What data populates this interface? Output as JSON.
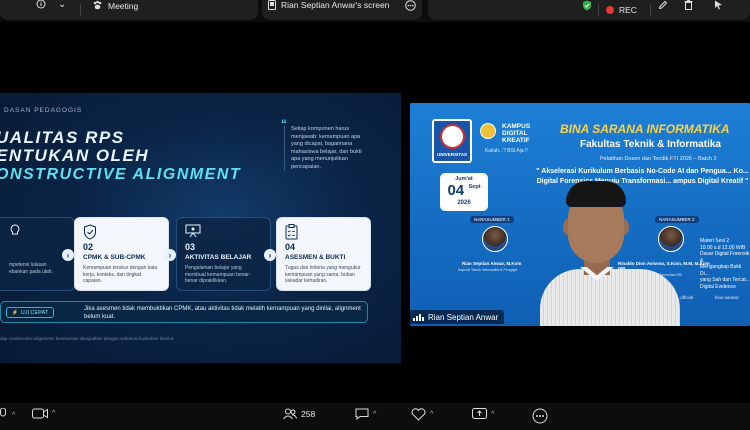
{
  "topbar": {
    "info_icon": "info-icon",
    "meeting_label": "Meeting",
    "screen_label": "Rian Septian Anwar's screen",
    "rec_label": "REC"
  },
  "slide": {
    "kicker": "DASAN PEDAGOGIS",
    "title_line1": "UALITAS RPS",
    "title_line2": "ENTUKAN OLEH",
    "title_line3": "ONSTRUCTIVE ALIGNMENT",
    "side_note": "Setiap komponen harus menjawab: kemampuan apa yang dicapai, bagaimana mahasiswa belajar, dan bukti apa yang menunjukkan pencapaian.",
    "cards": [
      {
        "num": "",
        "title": "",
        "desc": "mpetensi lulusan ebankan pada ulah."
      },
      {
        "num": "02",
        "title": "CPMK & SUB-CPMK",
        "desc": "Kemampuan terukur dengan kata kerja, konteks, dan tingkat capaian."
      },
      {
        "num": "03",
        "title": "AKTIVITAS BELAJAR",
        "desc": "Pengalaman belajar yang membuat kemampuan benar-benar dipraktikkan."
      },
      {
        "num": "04",
        "title": "ASESMEN & BUKTI",
        "desc": "Tugas dan kriteria yang mengukur kemampuan yang sama, bukan sekadar kehadiran."
      }
    ],
    "uji_label": "UJI CEPAT",
    "uji_text": "Jika asesmen tidak membuktikan CPMK, atau aktivitas tidak melatih kemampuan yang dinilai, alignment belum kuat.",
    "footnote": "dap constructive alignment: kesesuaian diwujudkan dengan sekuensi kurikulum tinstrut."
  },
  "webcam": {
    "univ_label": "UNIVERSITAS",
    "kdk": "KAMPUS DIGITAL KREATIF",
    "kuliah": "Kuliah...? BSI Aja !!",
    "bsi_title": "BINA SARANA INFORMATIKA",
    "fti_title": "Fakultas Teknik & Informatika",
    "pelatihan": "Pelatihan Dosen dan Tendik FTI 2026 – Batch 2",
    "akselerasi": "\" Akselerasi Kurikulum Berbasis No-Code AI dan Pengua... Ko... Digital Forensics Menuju Transformasi... ampus Digital Kreatif \"",
    "date_jumat": "Jum'at",
    "date_day": "04",
    "date_month": "Sept",
    "date_year": "2026",
    "speaker1_tag": "NARASUMBER 1",
    "speaker1_name": "Rian Septian Anwar, M.Kom",
    "speaker1_sub": "Kaprodi Teknik Informatika & Pengajar",
    "speaker2_tag": "NARASUMBER 2",
    "speaker2_name": "Rinaldo Dion Aviseno, S.Kom, M.M, M.Kom IPP",
    "speaker2_sub": "Kaprodi Sistem Informasi Universitas BSI",
    "materi": "Materi Sesi 2\n10.00 s.d 12.00 WIB\nDasar Digital Forensik &\nMengungkap Bukti Di...\nyang Sah dan Tercat...\nDigital Evidence",
    "sponsor_left": "@ubsi_official",
    "sponsor_right": "bina sarana",
    "name_tag": "Rian Septian Anwar"
  },
  "bottombar": {
    "participants": "258"
  }
}
